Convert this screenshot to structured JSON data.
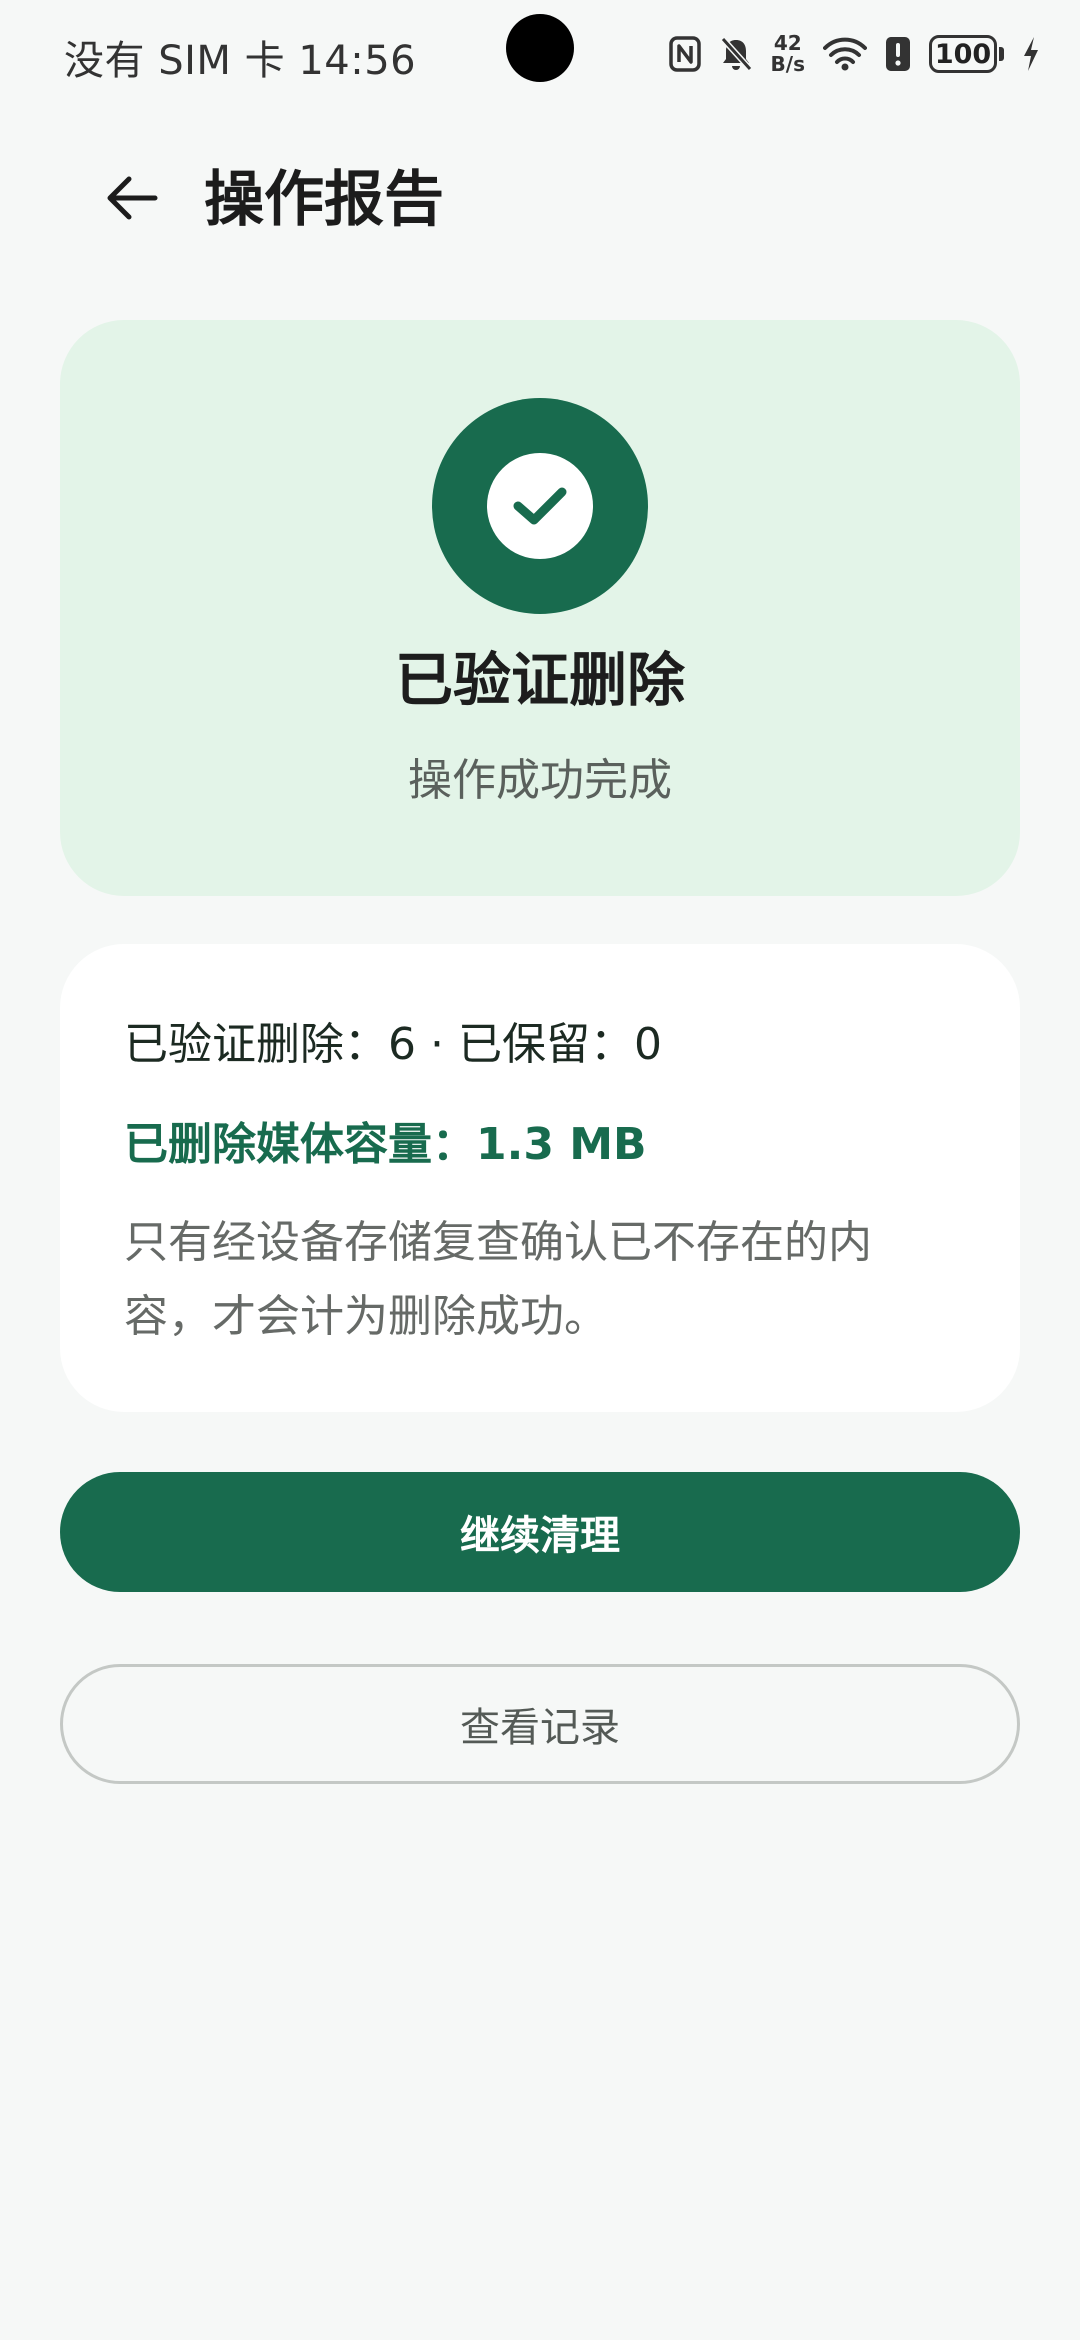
{
  "status_bar": {
    "carrier_time": "没有 SIM 卡 14:56",
    "net_speed_value": "42",
    "net_speed_unit": "B/s",
    "battery": "100",
    "icons": [
      "nfc-icon",
      "bell-muted-icon",
      "wifi-icon",
      "battery-alert-icon",
      "charging-bolt-icon"
    ]
  },
  "app_bar": {
    "title": "操作报告",
    "back_icon": "arrow-left-icon"
  },
  "result_card": {
    "icon": "check-circle-icon",
    "title": "已验证删除",
    "subtitle": "操作成功完成"
  },
  "details": {
    "counts": "已验证删除：6 · 已保留：0",
    "media_size": "已删除媒体容量：1.3 MB",
    "note": "只有经设备存储复查确认已不存在的内容，才会计为删除成功。"
  },
  "actions": {
    "continue_label": "继续清理",
    "history_label": "查看记录"
  },
  "colors": {
    "background": "#f6f8f7",
    "accent": "#186b4e",
    "success_card": "#e3f4e8",
    "card": "#ffffff"
  }
}
